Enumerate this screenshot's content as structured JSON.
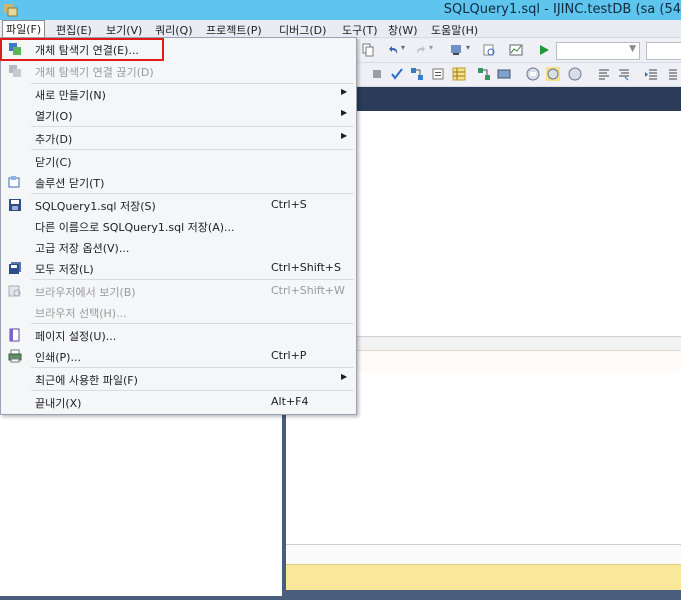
{
  "window": {
    "title": "SQLQuery1.sql - IJINC.testDB (sa (54"
  },
  "menubar": {
    "items": [
      "파일(F)",
      "편집(E)",
      "보기(V)",
      "쿼리(Q)",
      "프로젝트(P)",
      "디버그(D)",
      "도구(T)",
      "창(W)",
      "도움말(H)"
    ]
  },
  "file_menu": {
    "connect": {
      "label": "개체 탐색기 연결(E)...",
      "icon": "connect-object-explorer-icon"
    },
    "disconnect": {
      "label": "개체 탐색기 연결 끊기(D)",
      "icon": "disconnect-icon"
    },
    "new": {
      "label": "새로 만들기(N)"
    },
    "open": {
      "label": "열기(O)"
    },
    "add": {
      "label": "추가(D)"
    },
    "close": {
      "label": "닫기(C)"
    },
    "close_solution": {
      "label": "솔루션 닫기(T)",
      "icon": "close-solution-icon"
    },
    "save": {
      "label": "SQLQuery1.sql 저장(S)",
      "shortcut": "Ctrl+S",
      "icon": "save-icon"
    },
    "save_as": {
      "label": "다른 이름으로 SQLQuery1.sql 저장(A)..."
    },
    "advanced_save": {
      "label": "고급 저장 옵션(V)..."
    },
    "save_all": {
      "label": "모두 저장(L)",
      "shortcut": "Ctrl+Shift+S",
      "icon": "save-all-icon"
    },
    "view_in_browser": {
      "label": "브라우저에서 보기(B)",
      "shortcut": "Ctrl+Shift+W",
      "icon": "view-in-browser-icon"
    },
    "browse_with": {
      "label": "브라우저 선택(H)..."
    },
    "page_setup": {
      "label": "페이지 설정(U)...",
      "icon": "page-setup-icon"
    },
    "print": {
      "label": "인쇄(P)...",
      "shortcut": "Ctrl+P",
      "icon": "print-icon"
    },
    "recent": {
      "label": "최근에 사용한 파일(F)"
    },
    "exit": {
      "label": "끝내기(X)",
      "shortcut": "Alt+F4"
    }
  },
  "colors": {
    "titlebar": "#5fc5ef",
    "highlight": "#e11a1a",
    "panel_border": "#4a5d7c",
    "status": "#f9e79a"
  }
}
